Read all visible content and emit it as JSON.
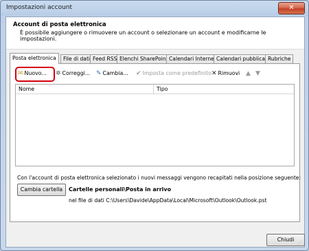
{
  "window": {
    "title": "Impostazioni account",
    "close_glyph": "✕"
  },
  "header": {
    "title": "Account di posta elettronica",
    "description": "È possibile aggiungere o rimuovere un account o selezionare un account e modificarne le impostazioni."
  },
  "tabs": [
    {
      "label": "Posta elettronica",
      "active": true
    },
    {
      "label": "File di dati"
    },
    {
      "label": "Feed RSS"
    },
    {
      "label": "Elenchi SharePoint"
    },
    {
      "label": "Calendari Internet"
    },
    {
      "label": "Calendari pubblicati"
    },
    {
      "label": "Rubriche"
    }
  ],
  "toolbar": {
    "new": {
      "label": "Nuovo...",
      "icon": "new-account-icon"
    },
    "repair": {
      "label": "Correggi...",
      "icon": "repair-icon"
    },
    "change": {
      "label": "Cambia...",
      "icon": "change-icon"
    },
    "set_default": {
      "label": "Imposta come predefinito",
      "icon": "checkmark-icon",
      "disabled": true
    },
    "remove": {
      "label": "Rimuovi",
      "icon": "remove-icon"
    },
    "move_up": {
      "icon": "arrow-up-icon",
      "disabled": true
    },
    "move_down": {
      "icon": "arrow-down-icon",
      "disabled": true
    }
  },
  "list": {
    "columns": [
      "Nome",
      "Tipo"
    ],
    "rows": []
  },
  "delivery": {
    "info": "Con l'account di posta elettronica selezionato i nuovi messaggi vengono recapitati nella posizione seguente:",
    "change_folder_label": "Cambia cartella",
    "folder_name": "Cartelle personali\\Posta in arrivo",
    "file_path": "nel file di dati C:\\Users\\Davide\\AppData\\Local\\Microsoft\\Outlook\\Outlook.pst"
  },
  "footer": {
    "close_label": "Chiudi"
  },
  "colors": {
    "highlight": "#d4000f",
    "titlebar": "#b8cde6",
    "close_button": "#c24128"
  }
}
